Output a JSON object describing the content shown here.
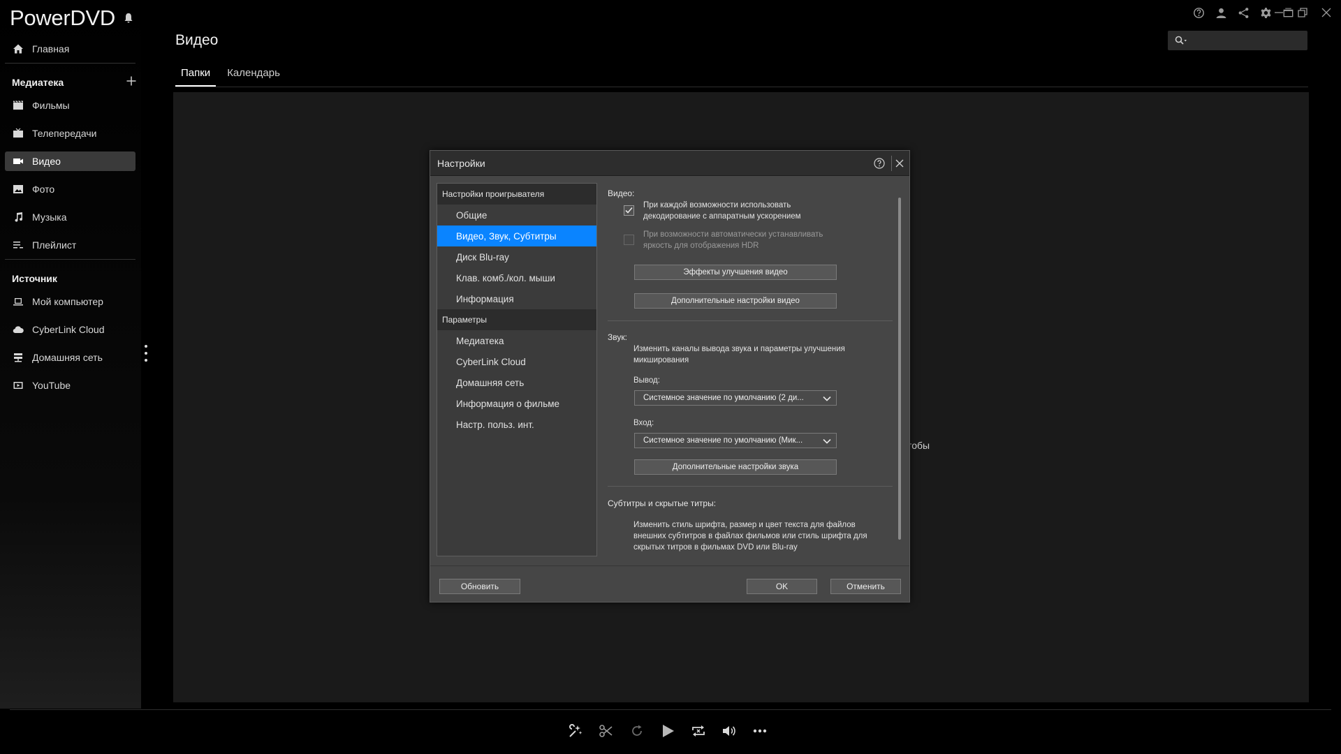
{
  "app": {
    "title": "PowerDVD"
  },
  "sidebar": {
    "home": "Главная",
    "library_heading": "Медиатека",
    "library_items": [
      "Фильмы",
      "Телепередачи",
      "Видео",
      "Фото",
      "Музыка",
      "Плейлист"
    ],
    "active_item": "Видео",
    "source_heading": "Источник",
    "source_items": [
      "Мой компьютер",
      "CyberLink Cloud",
      "Домашняя сеть",
      "YouTube"
    ]
  },
  "header": {
    "page_title": "Видео",
    "search": {
      "value": "",
      "placeholder": ""
    },
    "tabs": [
      "Папки",
      "Календарь"
    ],
    "active_tab": "Папки"
  },
  "background": {
    "partial_text": "тобы"
  },
  "dialog": {
    "title": "Настройки",
    "nav": {
      "group_player": "Настройки проигрывателя",
      "player_items": [
        "Общие",
        "Видео, Звук, Субтитры",
        "Диск Blu-ray",
        "Клав. комб./кол. мыши",
        "Информация"
      ],
      "group_params": "Параметры",
      "param_items": [
        "Медиатека",
        "CyberLink Cloud",
        "Домашняя сеть",
        "Информация о фильме",
        "Настр. польз. инт."
      ],
      "selected": "Видео, Звук, Субтитры"
    },
    "video": {
      "heading": "Видео:",
      "hw_decode_line1": "При каждой возможности использовать",
      "hw_decode_line2": "декодирование с аппаратным ускорением",
      "hw_decode_checked": true,
      "hdr_line1": "При возможности автоматически устанавливать",
      "hdr_line2": "яркость для отображения HDR",
      "hdr_checked": false,
      "effects_button": "Эффекты улучшения видео",
      "advanced_button": "Дополнительные настройки видео"
    },
    "audio": {
      "heading": "Звук:",
      "desc_line1": "Изменить каналы вывода звука и параметры улучшения",
      "desc_line2": "микширования",
      "output_label": "Вывод:",
      "output_value": "Системное значение по умолчанию  (2 ди...",
      "input_label": "Вход:",
      "input_value": "Системное значение по умолчанию  (Мик...",
      "advanced_button": "Дополнительные настройки звука"
    },
    "subtitles": {
      "heading": "Субтитры и скрытые титры:",
      "desc_line1": "Изменить стиль шрифта, размер и цвет текста для файлов",
      "desc_line2": "внешних субтитров в файлах фильмов или стиль шрифта для",
      "desc_line3": "скрытых титров в фильмах DVD или Blu-ray"
    },
    "footer": {
      "update": "Обновить",
      "ok": "OK",
      "cancel": "Отменить"
    }
  },
  "colors": {
    "accent": "#0a84ff",
    "background": "#000000",
    "dialog": "#464646"
  }
}
